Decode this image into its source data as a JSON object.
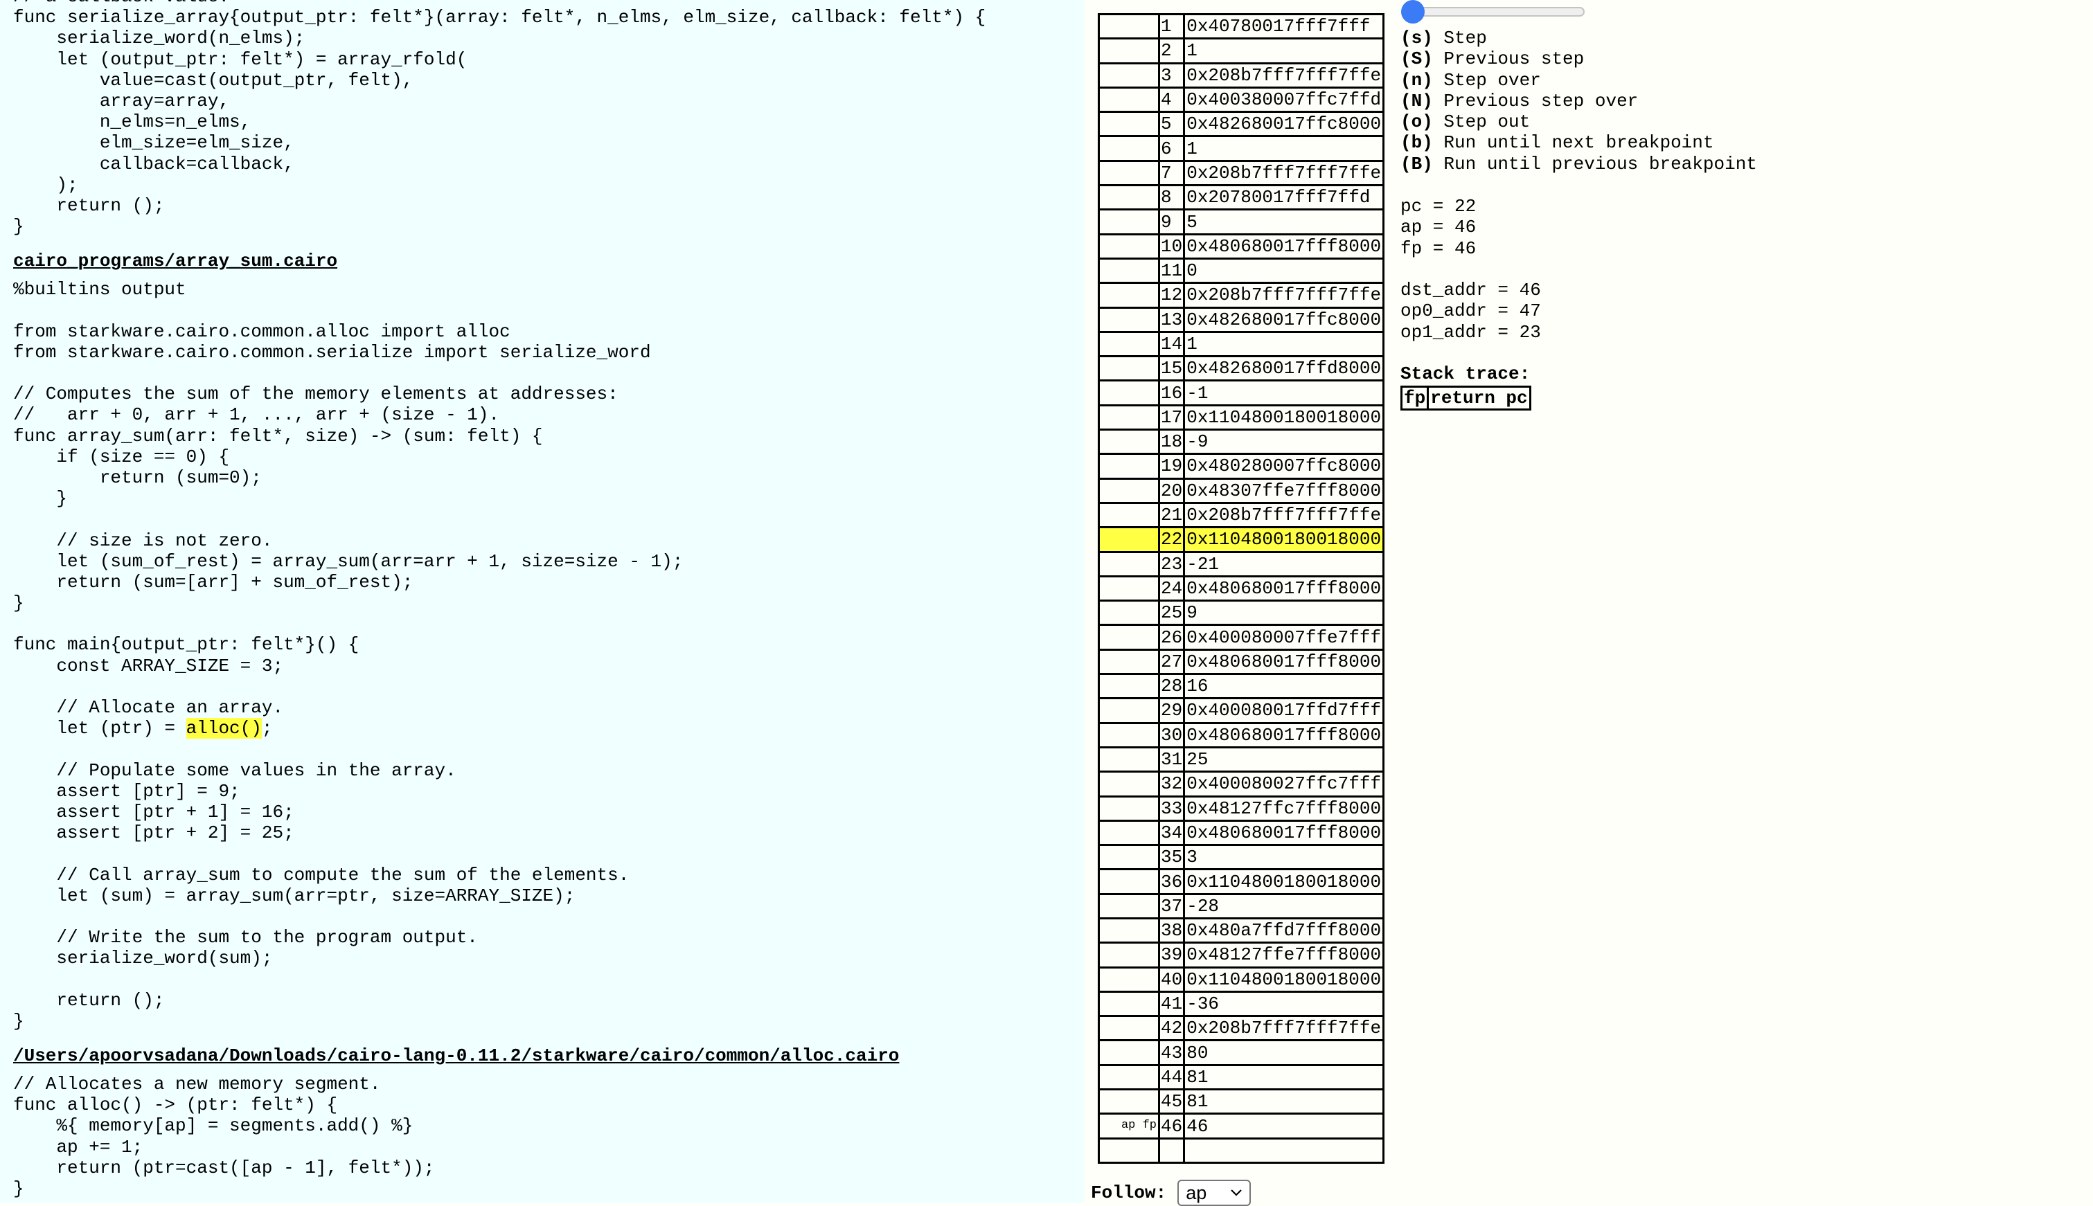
{
  "code": {
    "sections": [
      {
        "header": "",
        "lines": [
          "// a callback value.",
          "func serialize_array{output_ptr: felt*}(array: felt*, n_elms, elm_size, callback: felt*) {",
          "    serialize_word(n_elms);",
          "    let (output_ptr: felt*) = array_rfold(",
          "        value=cast(output_ptr, felt),",
          "        array=array,",
          "        n_elms=n_elms,",
          "        elm_size=elm_size,",
          "        callback=callback,",
          "    );",
          "    return ();",
          "}"
        ]
      },
      {
        "header": "cairo_programs/array_sum.cairo",
        "lines": [
          "%builtins output",
          "",
          "from starkware.cairo.common.alloc import alloc",
          "from starkware.cairo.common.serialize import serialize_word",
          "",
          "// Computes the sum of the memory elements at addresses:",
          "//   arr + 0, arr + 1, ..., arr + (size - 1).",
          "func array_sum(arr: felt*, size) -> (sum: felt) {",
          "    if (size == 0) {",
          "        return (sum=0);",
          "    }",
          "",
          "    // size is not zero.",
          "    let (sum_of_rest) = array_sum(arr=arr + 1, size=size - 1);",
          "    return (sum=[arr] + sum_of_rest);",
          "}",
          "",
          "func main{output_ptr: felt*}() {",
          "    const ARRAY_SIZE = 3;",
          "",
          "    // Allocate an array.",
          {
            "pre": "    let (ptr) = ",
            "hl": "alloc()",
            "post": ";"
          },
          "",
          "    // Populate some values in the array.",
          "    assert [ptr] = 9;",
          "    assert [ptr + 1] = 16;",
          "    assert [ptr + 2] = 25;",
          "",
          "    // Call array_sum to compute the sum of the elements.",
          "    let (sum) = array_sum(arr=ptr, size=ARRAY_SIZE);",
          "",
          "    // Write the sum to the program output.",
          "    serialize_word(sum);",
          "",
          "    return ();",
          "}"
        ]
      },
      {
        "header": "/Users/apoorvsadana/Downloads/cairo-lang-0.11.2/starkware/cairo/common/alloc.cairo",
        "lines": [
          "// Allocates a new memory segment.",
          "func alloc() -> (ptr: felt*) {",
          "    %{ memory[ap] = segments.add() %}",
          "    ap += 1;",
          "    return (ptr=cast([ap - 1], felt*));",
          "}"
        ]
      }
    ],
    "highlight_color": "#ffff44"
  },
  "memory": {
    "current_address": "22",
    "rows": [
      {
        "mark": "",
        "addr": "1",
        "value": "0x40780017fff7fff"
      },
      {
        "mark": "",
        "addr": "2",
        "value": "1"
      },
      {
        "mark": "",
        "addr": "3",
        "value": "0x208b7fff7fff7ffe"
      },
      {
        "mark": "",
        "addr": "4",
        "value": "0x400380007ffc7ffd"
      },
      {
        "mark": "",
        "addr": "5",
        "value": "0x482680017ffc8000"
      },
      {
        "mark": "",
        "addr": "6",
        "value": "1"
      },
      {
        "mark": "",
        "addr": "7",
        "value": "0x208b7fff7fff7ffe"
      },
      {
        "mark": "",
        "addr": "8",
        "value": "0x20780017fff7ffd"
      },
      {
        "mark": "",
        "addr": "9",
        "value": "5"
      },
      {
        "mark": "",
        "addr": "10",
        "value": "0x480680017fff8000"
      },
      {
        "mark": "",
        "addr": "11",
        "value": "0"
      },
      {
        "mark": "",
        "addr": "12",
        "value": "0x208b7fff7fff7ffe"
      },
      {
        "mark": "",
        "addr": "13",
        "value": "0x482680017ffc8000"
      },
      {
        "mark": "",
        "addr": "14",
        "value": "1"
      },
      {
        "mark": "",
        "addr": "15",
        "value": "0x482680017ffd8000"
      },
      {
        "mark": "",
        "addr": "16",
        "value": "-1"
      },
      {
        "mark": "",
        "addr": "17",
        "value": "0x1104800180018000"
      },
      {
        "mark": "",
        "addr": "18",
        "value": "-9"
      },
      {
        "mark": "",
        "addr": "19",
        "value": "0x480280007ffc8000"
      },
      {
        "mark": "",
        "addr": "20",
        "value": "0x48307ffe7fff8000"
      },
      {
        "mark": "",
        "addr": "21",
        "value": "0x208b7fff7fff7ffe"
      },
      {
        "mark": "",
        "addr": "22",
        "value": "0x1104800180018000"
      },
      {
        "mark": "",
        "addr": "23",
        "value": "-21"
      },
      {
        "mark": "",
        "addr": "24",
        "value": "0x480680017fff8000"
      },
      {
        "mark": "",
        "addr": "25",
        "value": "9"
      },
      {
        "mark": "",
        "addr": "26",
        "value": "0x400080007ffe7fff"
      },
      {
        "mark": "",
        "addr": "27",
        "value": "0x480680017fff8000"
      },
      {
        "mark": "",
        "addr": "28",
        "value": "16"
      },
      {
        "mark": "",
        "addr": "29",
        "value": "0x400080017ffd7fff"
      },
      {
        "mark": "",
        "addr": "30",
        "value": "0x480680017fff8000"
      },
      {
        "mark": "",
        "addr": "31",
        "value": "25"
      },
      {
        "mark": "",
        "addr": "32",
        "value": "0x400080027ffc7fff"
      },
      {
        "mark": "",
        "addr": "33",
        "value": "0x48127ffc7fff8000"
      },
      {
        "mark": "",
        "addr": "34",
        "value": "0x480680017fff8000"
      },
      {
        "mark": "",
        "addr": "35",
        "value": "3"
      },
      {
        "mark": "",
        "addr": "36",
        "value": "0x1104800180018000"
      },
      {
        "mark": "",
        "addr": "37",
        "value": "-28"
      },
      {
        "mark": "",
        "addr": "38",
        "value": "0x480a7ffd7fff8000"
      },
      {
        "mark": "",
        "addr": "39",
        "value": "0x48127ffe7fff8000"
      },
      {
        "mark": "",
        "addr": "40",
        "value": "0x1104800180018000"
      },
      {
        "mark": "",
        "addr": "41",
        "value": "-36"
      },
      {
        "mark": "",
        "addr": "42",
        "value": "0x208b7fff7fff7ffe"
      },
      {
        "mark": "",
        "addr": "43",
        "value": "80"
      },
      {
        "mark": "",
        "addr": "44",
        "value": "81"
      },
      {
        "mark": "",
        "addr": "45",
        "value": "81"
      },
      {
        "mark": "ap fp",
        "addr": "46",
        "value": "46"
      }
    ]
  },
  "follow": {
    "label": "Follow:",
    "selected": "ap",
    "icon": "chevron-down-icon"
  },
  "slider": {
    "value_fraction": 0.0,
    "color": "#3b7bf6"
  },
  "controls": [
    {
      "key": "(s)",
      "label": "Step"
    },
    {
      "key": "(S)",
      "label": "Previous step"
    },
    {
      "key": "(n)",
      "label": "Step over"
    },
    {
      "key": "(N)",
      "label": "Previous step over"
    },
    {
      "key": "(o)",
      "label": "Step out"
    },
    {
      "key": "(b)",
      "label": "Run until next breakpoint"
    },
    {
      "key": "(B)",
      "label": "Run until previous breakpoint"
    }
  ],
  "registers": [
    {
      "text": "pc = 22"
    },
    {
      "text": "ap = 46"
    },
    {
      "text": "fp = 46"
    }
  ],
  "operands": [
    {
      "text": "dst_addr = 46"
    },
    {
      "text": "op0_addr = 47"
    },
    {
      "text": "op1_addr = 23"
    }
  ],
  "stack_trace": {
    "title": "Stack trace:",
    "columns": [
      "fp",
      "return pc"
    ]
  }
}
